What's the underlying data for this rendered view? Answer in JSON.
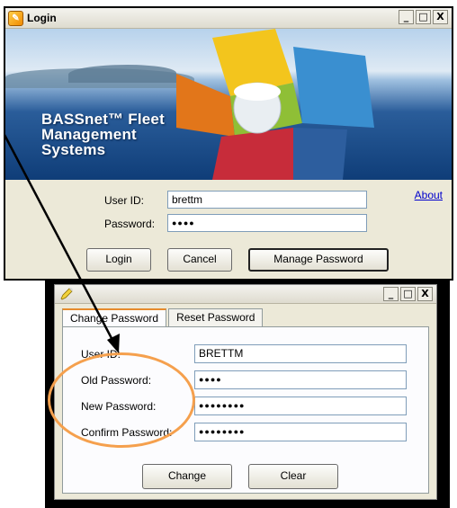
{
  "login_window": {
    "title": "Login",
    "controls": {
      "minimize": "_",
      "maximize": "□",
      "close": "X"
    },
    "banner": {
      "line1": "BASSnet™ Fleet",
      "line2": "Management",
      "line3": "Systems"
    },
    "user_id_label": "User ID:",
    "user_id_value": "brettm",
    "password_label": "Password:",
    "password_value": "●●●●",
    "about_link": "About",
    "buttons": {
      "login": "Login",
      "cancel": "Cancel",
      "manage_password": "Manage Password"
    }
  },
  "change_window": {
    "controls": {
      "minimize": "_",
      "maximize": "□",
      "close": "X"
    },
    "tabs": [
      {
        "label": "Change Password",
        "active": true
      },
      {
        "label": "Reset Password",
        "active": false
      }
    ],
    "fields": {
      "user_id_label": "User ID:",
      "user_id_value": "BRETTM",
      "old_password_label": "Old Password:",
      "old_password_value": "●●●●",
      "new_password_label": "New Password:",
      "new_password_value": "●●●●●●●●",
      "confirm_password_label": "Confirm Password:",
      "confirm_password_value": "●●●●●●●●"
    },
    "buttons": {
      "change": "Change",
      "clear": "Clear"
    }
  },
  "annotation": {
    "highlight_color": "#f5a04d",
    "arrow_color": "#000000"
  }
}
